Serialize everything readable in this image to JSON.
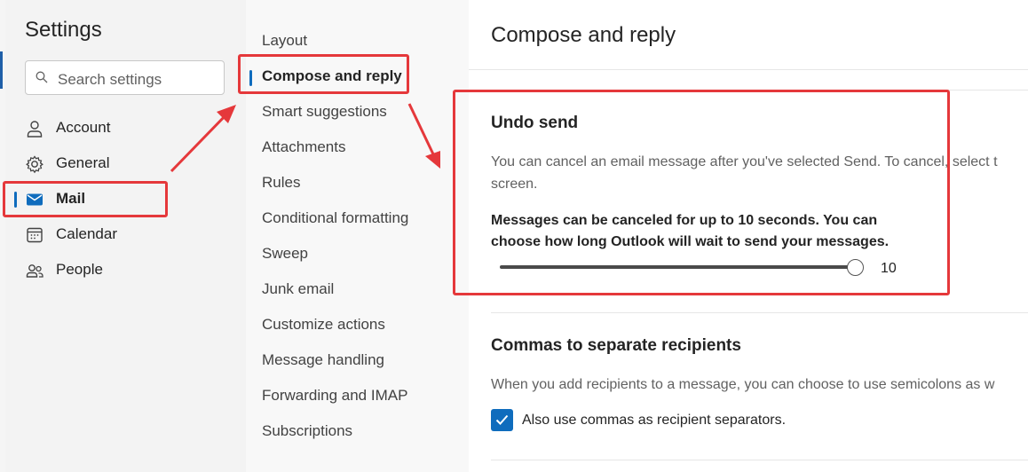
{
  "settings": {
    "title": "Settings",
    "search_placeholder": "Search settings"
  },
  "nav": [
    {
      "label": "Account",
      "icon": "person-icon"
    },
    {
      "label": "General",
      "icon": "gear-icon"
    },
    {
      "label": "Mail",
      "icon": "mail-icon",
      "active": true
    },
    {
      "label": "Calendar",
      "icon": "calendar-icon"
    },
    {
      "label": "People",
      "icon": "people-icon"
    }
  ],
  "subnav": [
    {
      "label": "Layout"
    },
    {
      "label": "Compose and reply",
      "active": true
    },
    {
      "label": "Smart suggestions"
    },
    {
      "label": "Attachments"
    },
    {
      "label": "Rules"
    },
    {
      "label": "Conditional formatting"
    },
    {
      "label": "Sweep"
    },
    {
      "label": "Junk email"
    },
    {
      "label": "Customize actions"
    },
    {
      "label": "Message handling"
    },
    {
      "label": "Forwarding and IMAP"
    },
    {
      "label": "Subscriptions"
    }
  ],
  "main": {
    "title": "Compose and reply",
    "undo_send": {
      "title": "Undo send",
      "desc_line1": "You can cancel an email message after you've selected Send. To cancel, select t",
      "desc_line2": "screen.",
      "bold_line1": "Messages can be canceled for up to 10 seconds. You can",
      "bold_line2": "choose how long Outlook will wait to send your messages.",
      "slider_value": "10",
      "slider_fraction": 1.0
    },
    "commas": {
      "title": "Commas to separate recipients",
      "desc": "When you add recipients to a message, you can choose to use semicolons as w",
      "checkbox_label": "Also use commas as recipient separators.",
      "checked": true
    }
  },
  "colors": {
    "accent": "#0f6cbd",
    "highlight": "#e5383b"
  }
}
